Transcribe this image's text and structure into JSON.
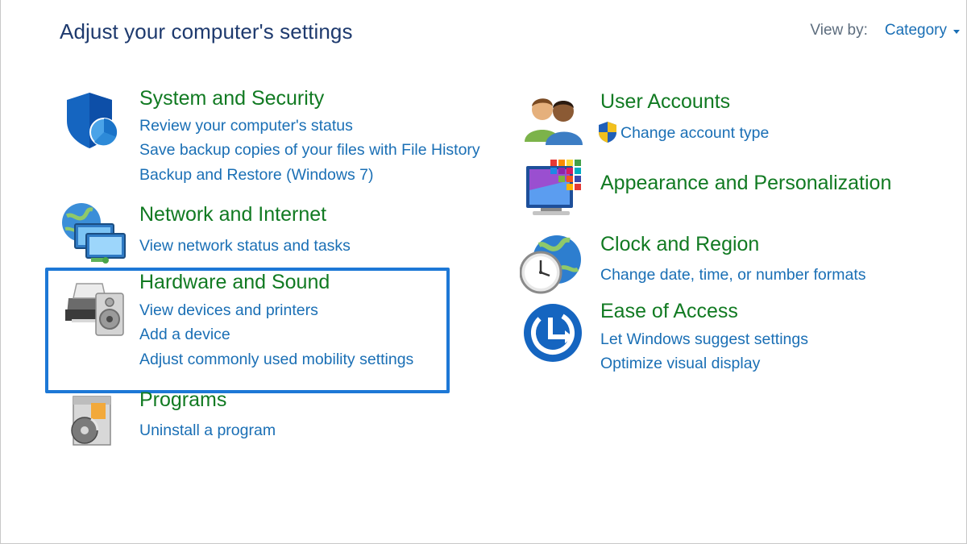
{
  "header": {
    "title": "Adjust your computer's settings",
    "view_by_label": "View by:",
    "view_by_value": "Category"
  },
  "categories": {
    "system_security": {
      "title": "System and Security",
      "icon": "shield-icon",
      "links": [
        "Review your computer's status",
        "Save backup copies of your files with File History",
        "Backup and Restore (Windows 7)"
      ]
    },
    "network_internet": {
      "title": "Network and Internet",
      "icon": "network-icon",
      "links": [
        "View network status and tasks"
      ]
    },
    "hardware_sound": {
      "title": "Hardware and Sound",
      "icon": "printer-speaker-icon",
      "links": [
        "View devices and printers",
        "Add a device",
        "Adjust commonly used mobility settings"
      ]
    },
    "programs": {
      "title": "Programs",
      "icon": "programs-icon",
      "links": [
        "Uninstall a program"
      ]
    },
    "user_accounts": {
      "title": "User Accounts",
      "icon": "users-icon",
      "links": [
        "Change account type"
      ]
    },
    "appearance": {
      "title": "Appearance and Personalization",
      "icon": "monitor-palette-icon",
      "links": []
    },
    "clock_region": {
      "title": "Clock and Region",
      "icon": "globe-clock-icon",
      "links": [
        "Change date, time, or number formats"
      ]
    },
    "ease_access": {
      "title": "Ease of Access",
      "icon": "ease-of-access-icon",
      "links": [
        "Let Windows suggest settings",
        "Optimize visual display"
      ]
    }
  },
  "colors": {
    "title_green": "#117a22",
    "link_blue": "#1a6fb5",
    "highlight": "#1d78d6"
  }
}
